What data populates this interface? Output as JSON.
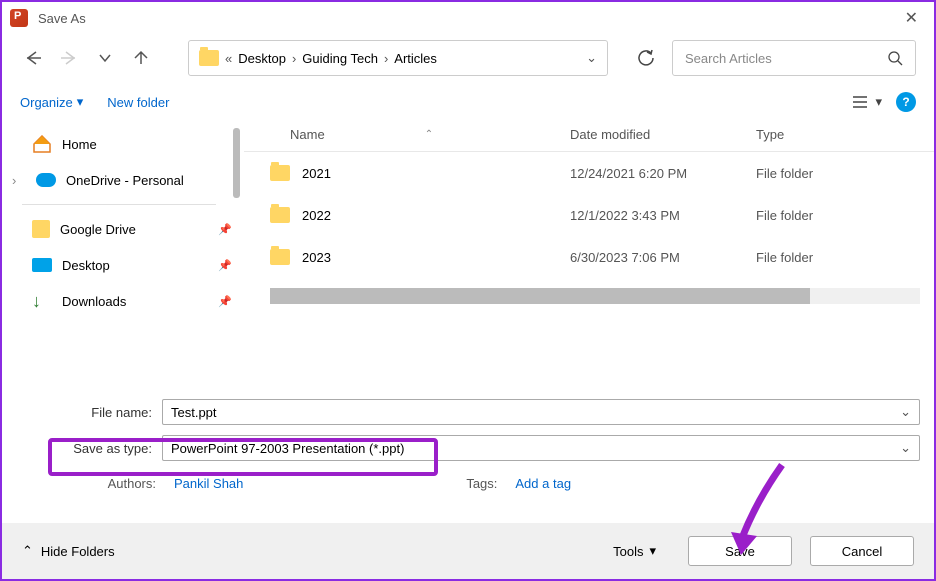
{
  "window": {
    "title": "Save As"
  },
  "nav": {
    "back": "←",
    "fwd": "→",
    "recent": "⌄",
    "up": "↑"
  },
  "breadcrumb": {
    "pre": "«",
    "p1": "Desktop",
    "p2": "Guiding Tech",
    "p3": "Articles"
  },
  "search": {
    "placeholder": "Search Articles"
  },
  "toolbar": {
    "organize": "Organize",
    "newfolder": "New folder"
  },
  "sidebar": {
    "home": "Home",
    "onedrive": "OneDrive - Personal",
    "gdrive": "Google Drive",
    "desktop": "Desktop",
    "downloads": "Downloads"
  },
  "columns": {
    "name": "Name",
    "date": "Date modified",
    "type": "Type"
  },
  "files": [
    {
      "name": "2021",
      "date": "12/24/2021 6:20 PM",
      "type": "File folder"
    },
    {
      "name": "2022",
      "date": "12/1/2022 3:43 PM",
      "type": "File folder"
    },
    {
      "name": "2023",
      "date": "6/30/2023 7:06 PM",
      "type": "File folder"
    }
  ],
  "form": {
    "filename_label": "File name:",
    "filename_value": "Test.ppt",
    "savetype_label": "Save as type:",
    "savetype_value": "PowerPoint 97-2003 Presentation (*.ppt)",
    "authors_label": "Authors:",
    "authors_value": "Pankil Shah",
    "tags_label": "Tags:",
    "tags_value": "Add a tag"
  },
  "footer": {
    "hide": "Hide Folders",
    "tools": "Tools",
    "save": "Save",
    "cancel": "Cancel"
  }
}
